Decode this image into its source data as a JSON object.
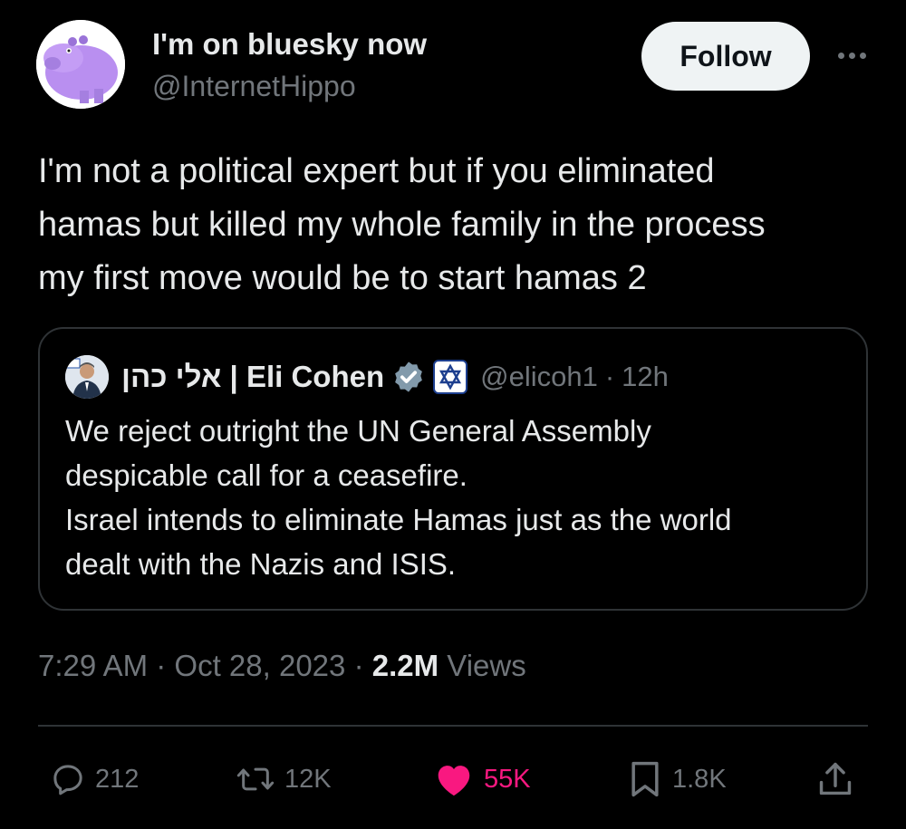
{
  "author": {
    "display_name": "I'm on bluesky now",
    "handle": "@InternetHippo",
    "avatar_icon": "purple-hippo-avatar",
    "avatar_color": "#b98ff0"
  },
  "header": {
    "follow_label": "Follow",
    "more_icon": "more-horizontal-icon"
  },
  "tweet": {
    "lines": [
      "I'm not a political expert but if you eliminated",
      "hamas but killed my whole family in the process",
      "my first move would be to start hamas 2"
    ]
  },
  "quote": {
    "display_name": "אלי כהן | Eli Cohen",
    "handle": "@elicoh1",
    "separator": "·",
    "time": "12h",
    "verified_color": "#829aab",
    "lines": [
      "We reject outright the UN General Assembly",
      "despicable call for a ceasefire.",
      "Israel intends to eliminate Hamas just as the world",
      "dealt with the Nazis and ISIS."
    ]
  },
  "meta": {
    "time": "7:29 AM",
    "separator": "·",
    "date": "Oct 28, 2023",
    "views_count": "2.2M",
    "views_label": "Views"
  },
  "actions": {
    "replies": "212",
    "reposts": "12K",
    "likes": "55K",
    "bookmarks": "1.8K",
    "like_color": "#f91880"
  }
}
